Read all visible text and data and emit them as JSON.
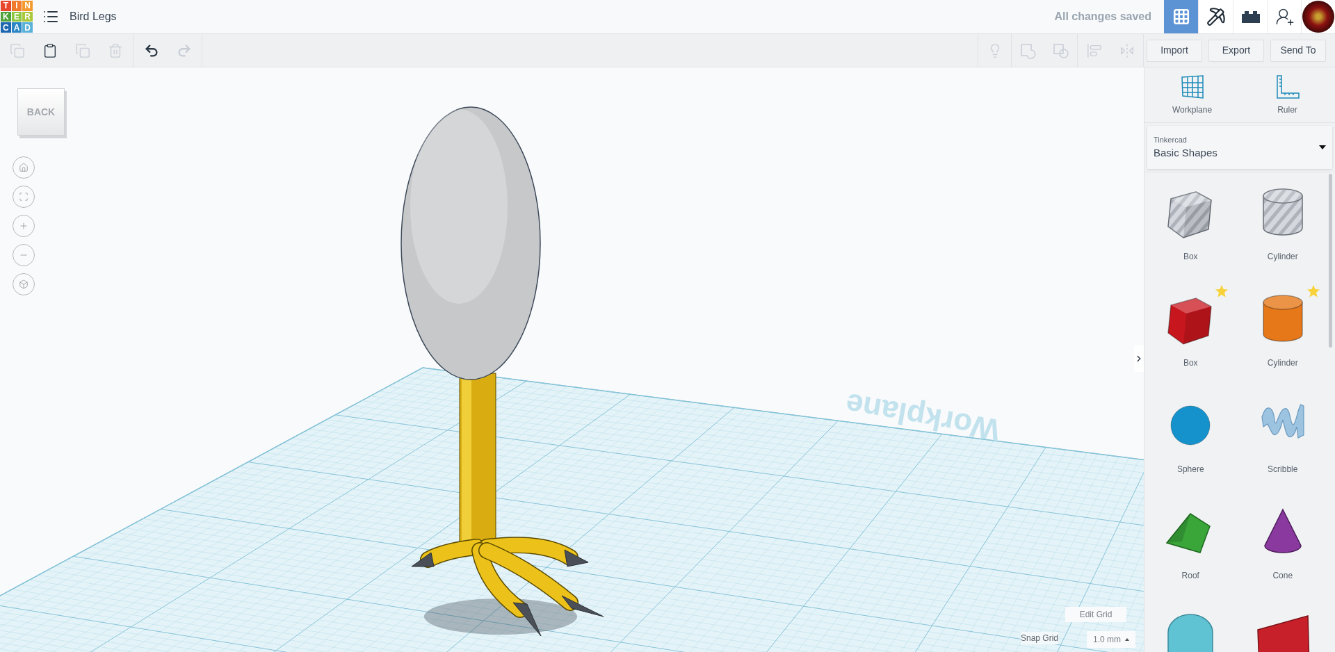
{
  "header": {
    "logo_letters": [
      {
        "text": "T",
        "color": "#e8482c"
      },
      {
        "text": "I",
        "color": "#f07b2c"
      },
      {
        "text": "N",
        "color": "#f49a2d"
      },
      {
        "text": "K",
        "color": "#4fa23a"
      },
      {
        "text": "E",
        "color": "#8cc63e"
      },
      {
        "text": "R",
        "color": "#a9c83a"
      },
      {
        "text": "C",
        "color": "#1d67b1"
      },
      {
        "text": "A",
        "color": "#2b86c5"
      },
      {
        "text": "D",
        "color": "#5ab1d8"
      }
    ],
    "title": "Bird Legs",
    "save_status": "All changes saved",
    "view_buttons": [
      {
        "kind": "grid",
        "selected": true
      },
      {
        "kind": "pickaxe",
        "selected": false
      },
      {
        "kind": "bricks",
        "selected": false
      }
    ]
  },
  "toolbar": {
    "edit_tools": [
      {
        "kind": "copy",
        "disabled": true
      },
      {
        "kind": "paste",
        "disabled": false
      },
      {
        "kind": "duplicate",
        "disabled": true
      },
      {
        "kind": "delete",
        "disabled": true
      }
    ],
    "history_tools": [
      {
        "kind": "undo",
        "disabled": false
      },
      {
        "kind": "redo",
        "disabled": true
      }
    ],
    "shape_tools": [
      {
        "kind": "notes",
        "disabled": true
      },
      {
        "kind": "group",
        "disabled": true
      },
      {
        "kind": "ungroup",
        "disabled": true
      },
      {
        "kind": "align",
        "disabled": true
      },
      {
        "kind": "mirror",
        "disabled": true
      }
    ],
    "actions": [
      "Import",
      "Export",
      "Send To"
    ]
  },
  "viewport": {
    "view_cube_label": "BACK",
    "view_controls": [
      {
        "kind": "home"
      },
      {
        "kind": "fit"
      },
      {
        "kind": "zoom-in"
      },
      {
        "kind": "zoom-out"
      },
      {
        "kind": "perspective"
      }
    ],
    "workplane_label": "Workplane",
    "edit_grid": "Edit Grid",
    "snap_grid_label": "Snap Grid",
    "snap_grid_value": "1.0 mm"
  },
  "panel": {
    "tools": [
      {
        "kind": "workplane",
        "label": "Workplane"
      },
      {
        "kind": "ruler",
        "label": "Ruler"
      }
    ],
    "library": {
      "caption": "Tinkercad",
      "value": "Basic Shapes"
    },
    "shapes": [
      {
        "kind": "box",
        "label": "Box",
        "color": "#b9bec6",
        "hole": true,
        "starred": false
      },
      {
        "kind": "cylinder",
        "label": "Cylinder",
        "color": "#b9bec6",
        "hole": true,
        "starred": false
      },
      {
        "kind": "box",
        "label": "Box",
        "color": "#c8161e",
        "hole": false,
        "starred": true
      },
      {
        "kind": "cylinder",
        "label": "Cylinder",
        "color": "#e6781a",
        "hole": false,
        "starred": true
      },
      {
        "kind": "sphere",
        "label": "Sphere",
        "color": "#1592cc",
        "hole": false,
        "starred": false
      },
      {
        "kind": "scribble",
        "label": "Scribble",
        "color": "#9cc3e0",
        "hole": false,
        "starred": false
      },
      {
        "kind": "roof",
        "label": "Roof",
        "color": "#3aa63a",
        "hole": false,
        "starred": false
      },
      {
        "kind": "cone",
        "label": "Cone",
        "color": "#8a3a9e",
        "hole": false,
        "starred": false
      },
      {
        "kind": "round",
        "color": "#5fc3d4",
        "hole": false,
        "starred": false
      },
      {
        "kind": "lettering",
        "color": "#c8202a",
        "hole": false,
        "starred": false
      }
    ]
  }
}
